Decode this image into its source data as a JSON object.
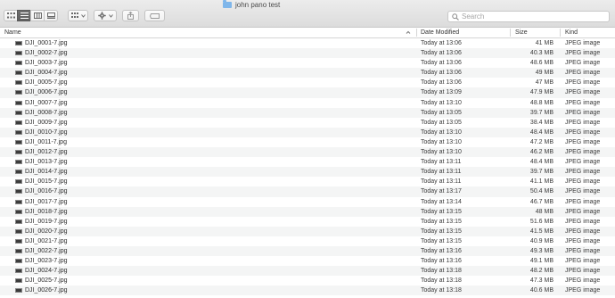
{
  "window": {
    "title": "john pano test"
  },
  "search": {
    "placeholder": "Search"
  },
  "columns": {
    "name": "Name",
    "date": "Date Modified",
    "size": "Size",
    "kind": "Kind"
  },
  "files": [
    {
      "name": "DJI_0001-7.jpg",
      "date": "Today at 13:06",
      "size": "41 MB",
      "kind": "JPEG image"
    },
    {
      "name": "DJI_0002-7.jpg",
      "date": "Today at 13:06",
      "size": "40.3 MB",
      "kind": "JPEG image"
    },
    {
      "name": "DJI_0003-7.jpg",
      "date": "Today at 13:06",
      "size": "48.6 MB",
      "kind": "JPEG image"
    },
    {
      "name": "DJI_0004-7.jpg",
      "date": "Today at 13:06",
      "size": "49 MB",
      "kind": "JPEG image"
    },
    {
      "name": "DJI_0005-7.jpg",
      "date": "Today at 13:06",
      "size": "47 MB",
      "kind": "JPEG image"
    },
    {
      "name": "DJI_0006-7.jpg",
      "date": "Today at 13:09",
      "size": "47.9 MB",
      "kind": "JPEG image"
    },
    {
      "name": "DJI_0007-7.jpg",
      "date": "Today at 13:10",
      "size": "48.8 MB",
      "kind": "JPEG image"
    },
    {
      "name": "DJI_0008-7.jpg",
      "date": "Today at 13:05",
      "size": "39.7 MB",
      "kind": "JPEG image"
    },
    {
      "name": "DJI_0009-7.jpg",
      "date": "Today at 13:05",
      "size": "38.4 MB",
      "kind": "JPEG image"
    },
    {
      "name": "DJI_0010-7.jpg",
      "date": "Today at 13:10",
      "size": "48.4 MB",
      "kind": "JPEG image"
    },
    {
      "name": "DJI_0011-7.jpg",
      "date": "Today at 13:10",
      "size": "47.2 MB",
      "kind": "JPEG image"
    },
    {
      "name": "DJI_0012-7.jpg",
      "date": "Today at 13:10",
      "size": "46.2 MB",
      "kind": "JPEG image"
    },
    {
      "name": "DJI_0013-7.jpg",
      "date": "Today at 13:11",
      "size": "48.4 MB",
      "kind": "JPEG image"
    },
    {
      "name": "DJI_0014-7.jpg",
      "date": "Today at 13:11",
      "size": "39.7 MB",
      "kind": "JPEG image"
    },
    {
      "name": "DJI_0015-7.jpg",
      "date": "Today at 13:11",
      "size": "41.1 MB",
      "kind": "JPEG image"
    },
    {
      "name": "DJI_0016-7.jpg",
      "date": "Today at 13:17",
      "size": "50.4 MB",
      "kind": "JPEG image"
    },
    {
      "name": "DJI_0017-7.jpg",
      "date": "Today at 13:14",
      "size": "46.7 MB",
      "kind": "JPEG image"
    },
    {
      "name": "DJI_0018-7.jpg",
      "date": "Today at 13:15",
      "size": "48 MB",
      "kind": "JPEG image"
    },
    {
      "name": "DJI_0019-7.jpg",
      "date": "Today at 13:15",
      "size": "51.6 MB",
      "kind": "JPEG image"
    },
    {
      "name": "DJI_0020-7.jpg",
      "date": "Today at 13:15",
      "size": "41.5 MB",
      "kind": "JPEG image"
    },
    {
      "name": "DJI_0021-7.jpg",
      "date": "Today at 13:15",
      "size": "40.9 MB",
      "kind": "JPEG image"
    },
    {
      "name": "DJI_0022-7.jpg",
      "date": "Today at 13:16",
      "size": "49.3 MB",
      "kind": "JPEG image"
    },
    {
      "name": "DJI_0023-7.jpg",
      "date": "Today at 13:16",
      "size": "49.1 MB",
      "kind": "JPEG image"
    },
    {
      "name": "DJI_0024-7.jpg",
      "date": "Today at 13:18",
      "size": "48.2 MB",
      "kind": "JPEG image"
    },
    {
      "name": "DJI_0025-7.jpg",
      "date": "Today at 13:18",
      "size": "47.3 MB",
      "kind": "JPEG image"
    },
    {
      "name": "DJI_0026-7.jpg",
      "date": "Today at 13:18",
      "size": "40.6 MB",
      "kind": "JPEG image"
    }
  ]
}
